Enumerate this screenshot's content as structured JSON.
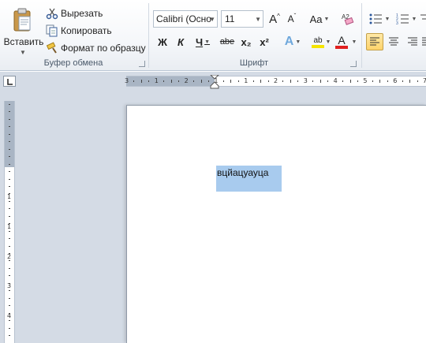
{
  "clipboard": {
    "paste_label": "Вставить",
    "cut_label": "Вырезать",
    "copy_label": "Копировать",
    "format_painter_label": "Формат по образцу",
    "group_label": "Буфер обмена"
  },
  "font": {
    "name_value": "Calibri (Осно",
    "size_value": "11",
    "grow_label": "A",
    "shrink_label": "A",
    "change_case_label": "Aa",
    "bold_label": "Ж",
    "italic_label": "К",
    "underline_label": "Ч",
    "strike_label": "abe",
    "subscript_label": "x₂",
    "superscript_label": "x²",
    "effects_label": "A",
    "highlight_label": "ab",
    "color_label": "A",
    "group_label": "Шрифт",
    "highlight_color": "#f5e400",
    "font_color": "#e02020"
  },
  "paragraph": {
    "active_align": "left"
  },
  "ruler": {
    "h_labels": [
      "3",
      "1",
      "2",
      "1",
      "1",
      "2",
      "3",
      "4",
      "5",
      "6",
      "7"
    ],
    "v_labels": [
      "1",
      "1",
      "2",
      "3",
      "4",
      "5"
    ]
  },
  "document": {
    "text": "вцйацуауца"
  },
  "colors": {
    "selection": "#a8cbee",
    "ruler_margin": "#a9b5c4",
    "doc_background": "#d4dbe5"
  }
}
